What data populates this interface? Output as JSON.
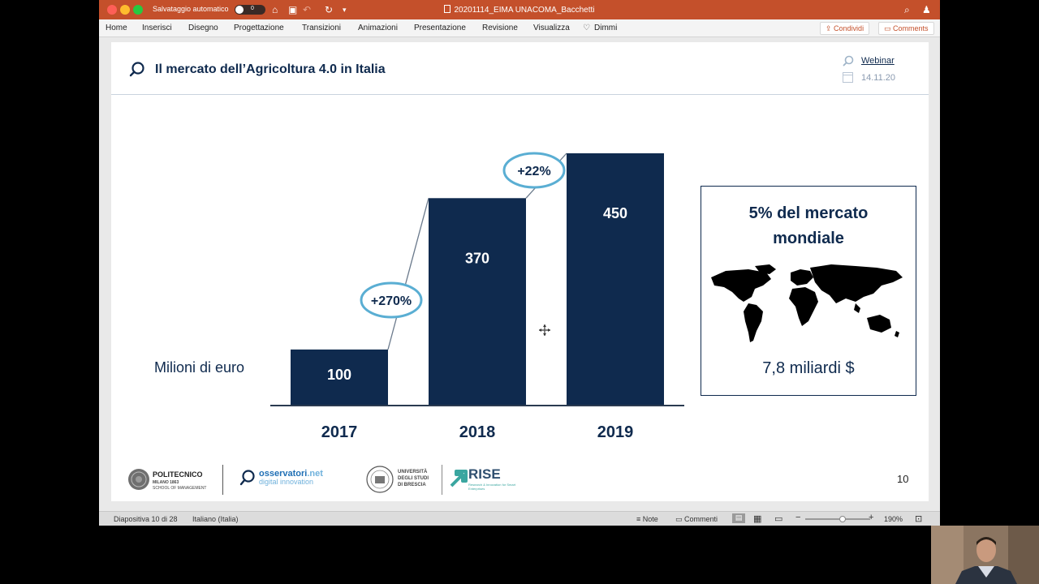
{
  "titlebar": {
    "autosave_label": "Salvataggio automatico",
    "autosave_state": "0",
    "document_title": "20201114_EIMA UNACOMA_Bacchetti"
  },
  "ribbon": {
    "tabs": [
      "Home",
      "Inserisci",
      "Disegno",
      "Progettazione",
      "Transizioni",
      "Animazioni",
      "Presentazione",
      "Revisione",
      "Visualizza",
      "Dimmi"
    ],
    "share_label": "Condividi",
    "comments_label": "Comments"
  },
  "slide": {
    "title": "Il mercato dell’Agricoltura 4.0 in Italia",
    "webinar_label": "Webinar",
    "date": "14.11.20",
    "unit_label": "Milioni di euro",
    "info_box": {
      "title_line1": "5% del mercato",
      "title_line2": "mondiale",
      "value": "7,8 miliardi $"
    },
    "logos": {
      "polimi_name": "POLITECNICO",
      "polimi_sub1": "MILANO 1863",
      "polimi_sub2": "SCHOOL OF MANAGEMENT",
      "osservatori_name": "osservatori",
      "osservatori_suffix": ".net",
      "osservatori_sub": "digital innovation",
      "unibs_line1": "UNIVERSITÀ",
      "unibs_line2": "DEGLI STUDI",
      "unibs_line3": "DI BRESCIA",
      "rise_name": "RISE",
      "rise_sub": "Research & Innovation for Smart Enterprises"
    },
    "page_number": "10"
  },
  "chart_data": {
    "type": "bar",
    "categories": [
      "2017",
      "2018",
      "2019"
    ],
    "values": [
      100,
      370,
      450
    ],
    "value_labels": [
      "100",
      "370",
      "450"
    ],
    "growth_annotations": [
      "+270%",
      "+22%"
    ],
    "ylim": [
      0,
      450
    ],
    "grid": false,
    "colors": {
      "bar": "#0f2a4e",
      "bubble": "#5aaed3"
    }
  },
  "statusbar": {
    "slide_counter": "Diapositiva 10 di 28",
    "language": "Italiano (Italia)",
    "notes_label": "Note",
    "comments_label": "Commenti",
    "zoom": "190%"
  }
}
